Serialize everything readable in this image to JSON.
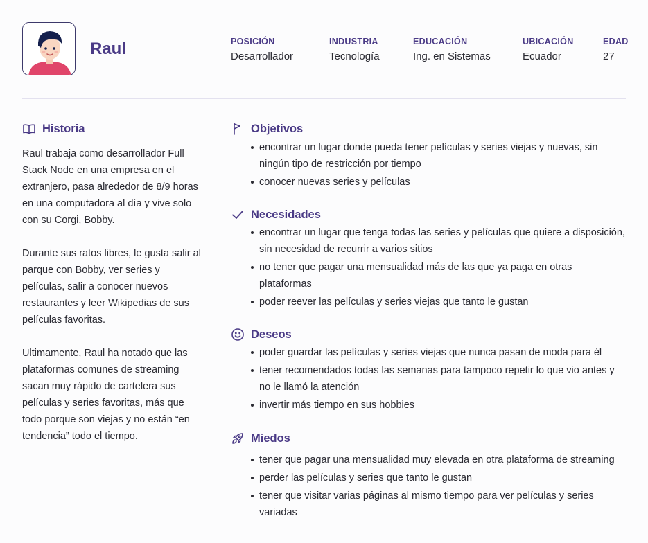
{
  "profile": {
    "name": "Raul",
    "attributes": [
      {
        "label": "POSICIÓN",
        "value": "Desarrollador"
      },
      {
        "label": "INDUSTRIA",
        "value": "Tecnología"
      },
      {
        "label": "EDUCACIÓN",
        "value": "Ing. en Sistemas"
      },
      {
        "label": "UBICACIÓN",
        "value": "Ecuador"
      },
      {
        "label": "EDAD",
        "value": "27"
      }
    ]
  },
  "historia": {
    "title": "Historia",
    "icon": "book-icon",
    "paragraphs": [
      "Raul trabaja como desarrollador Full Stack Node en una empresa en el extranjero, pasa alrededor de 8/9 horas en una computadora al día y vive solo con su Corgi, Bobby.",
      "Durante sus ratos libres, le gusta salir al parque con Bobby, ver series y películas, salir a conocer nuevos restaurantes y leer Wikipedias de sus películas favoritas.",
      "Ultimamente, Raul ha notado que las plataformas comunes de streaming sacan muy rápido de cartelera sus películas y series favoritas, más que todo porque son viejas y no están “en tendencia” todo el tiempo."
    ]
  },
  "objetivos": {
    "title": "Objetivos",
    "icon": "flag-icon",
    "items": [
      "encontrar un lugar donde pueda tener películas y series viejas y nuevas, sin ningún tipo de restricción por tiempo",
      "conocer nuevas series y películas"
    ]
  },
  "necesidades": {
    "title": "Necesidades",
    "icon": "check-icon",
    "items": [
      "encontrar un lugar que tenga todas las series y películas que quiere a disposición, sin necesidad de recurrir a varios sitios",
      "no tener que pagar una mensualidad más de las que ya paga en otras plataformas",
      "poder reever las películas y series viejas que tanto le gustan"
    ]
  },
  "deseos": {
    "title": "Deseos",
    "icon": "smile-icon",
    "items": [
      "poder guardar las películas y series viejas que nunca pasan de moda para él",
      "tener recomendados todas las semanas para tampoco repetir lo que vio antes y no le llamó la atención",
      "invertir más tiempo en sus hobbies"
    ]
  },
  "miedos": {
    "title": "Miedos",
    "icon": "rocket-icon",
    "items": [
      "tener que pagar una mensualidad muy elevada en otra plataforma de streaming",
      "perder las películas y series que tanto le gustan",
      "tener que visitar varias páginas al mismo tiempo para ver películas y series variadas"
    ]
  },
  "colors": {
    "accent": "#4a3a86",
    "text": "#2b2b33",
    "divider": "#e3e1ef",
    "avatar_shirt": "#e0456a"
  }
}
